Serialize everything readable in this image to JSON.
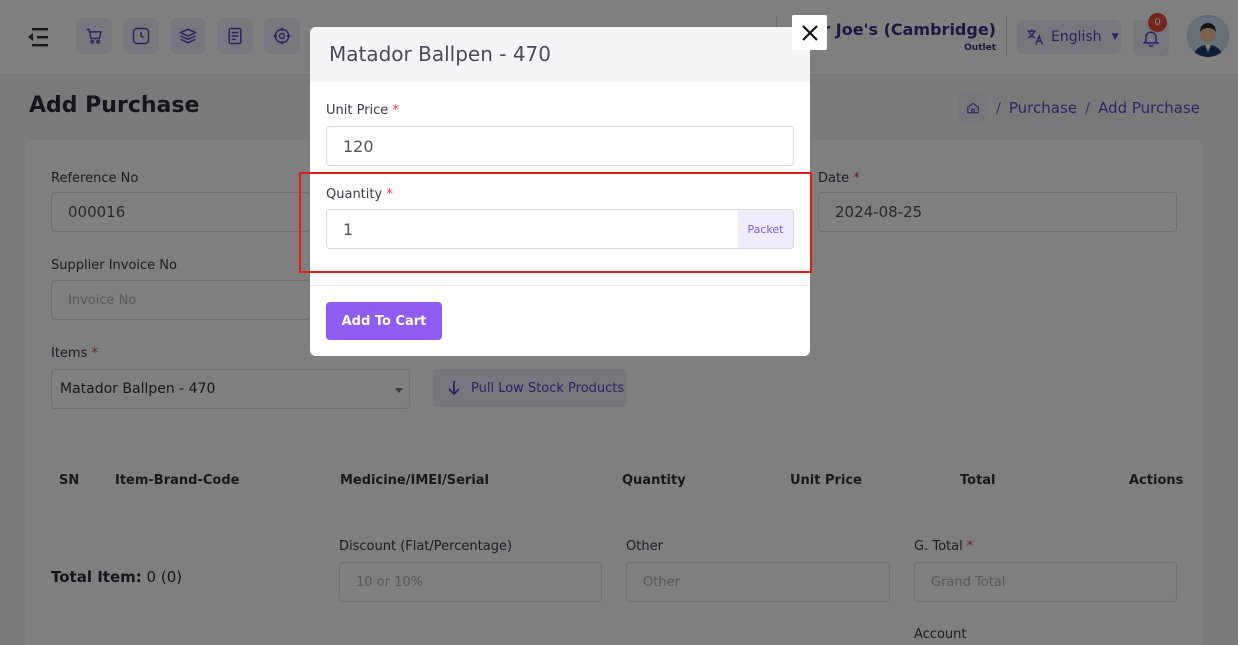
{
  "topbar": {
    "icons": [
      "menu-toggle-icon",
      "cart-icon",
      "clock-icon",
      "layers-icon",
      "receipt-icon",
      "target-icon"
    ],
    "outlet_name": "er Joe's (Cambridge)",
    "outlet_sub": "Outlet",
    "language": "English",
    "notification_count": "0"
  },
  "page": {
    "title": "Add Purchase",
    "breadcrumb": [
      "Purchase",
      "Add Purchase"
    ]
  },
  "form": {
    "reference_label": "Reference No",
    "reference_value": "000016",
    "date_label": "Date",
    "date_value": "2024-08-25",
    "supplier_invoice_label": "Supplier Invoice No",
    "supplier_invoice_placeholder": "Invoice No",
    "items_label": "Items",
    "items_selected": "Matador Ballpen - 470",
    "pull_low_stock_label": "Pull Low Stock Products",
    "table_headers": [
      "SN",
      "Item-Brand-Code",
      "Medicine/IMEI/Serial",
      "Quantity",
      "Unit Price",
      "Total",
      "Actions"
    ],
    "total_item_label": "Total Item:",
    "total_item_value": "0 (0)",
    "discount_label": "Discount (Flat/Percentage)",
    "discount_placeholder": "10 or 10%",
    "other_label": "Other",
    "other_placeholder": "Other",
    "gtotal_label": "G. Total",
    "gtotal_placeholder": "Grand Total",
    "account_label": "Account"
  },
  "modal": {
    "title": "Matador Ballpen - 470",
    "unit_price_label": "Unit Price",
    "unit_price_value": "120",
    "quantity_label": "Quantity",
    "quantity_value": "1",
    "unit": "Packet",
    "add_to_cart_label": "Add To Cart",
    "required_mark": "*"
  },
  "colors": {
    "accent": "#8e5cf0",
    "brand_dark": "#3d2e85",
    "highlight": "#e21b1b"
  }
}
